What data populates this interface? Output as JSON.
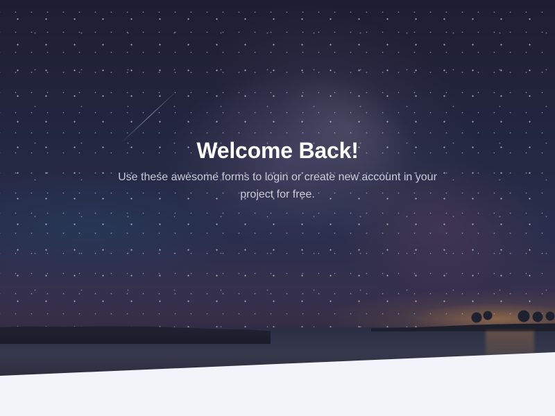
{
  "hero": {
    "title": "Welcome Back!",
    "subtitle": "Use these awesome forms to login or create new account in your project for free.",
    "background": "night-sky-seascape"
  },
  "colors": {
    "section_background": "#f1f4f8",
    "title_text": "#ffffff",
    "subtitle_text": "#ebebf5"
  }
}
